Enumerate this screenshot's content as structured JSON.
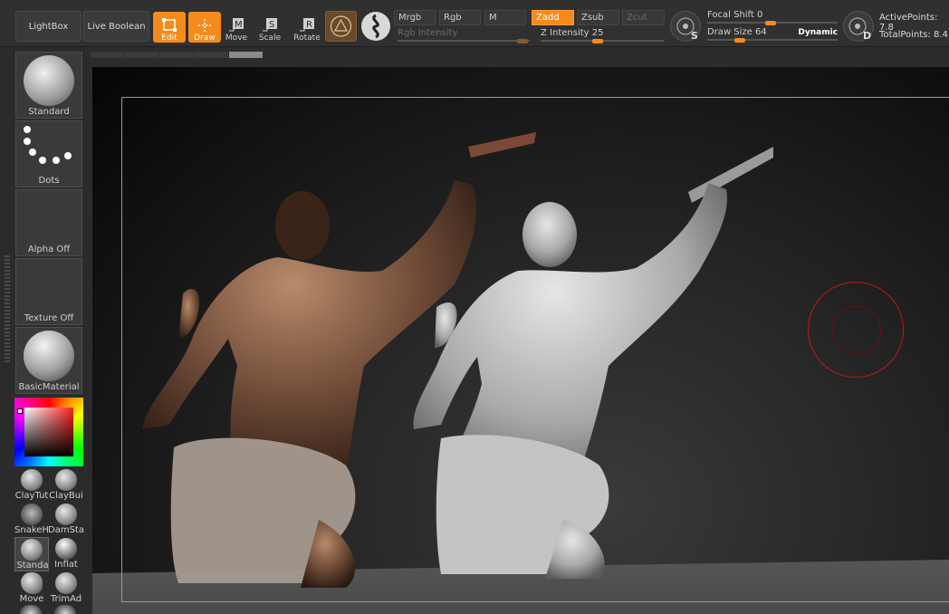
{
  "toolbar": {
    "lightbox": "LightBox",
    "live_boolean": "Live Boolean",
    "tools": [
      {
        "label": "Edit",
        "active": true
      },
      {
        "label": "Draw",
        "active": true
      },
      {
        "label": "Move",
        "active": false
      },
      {
        "label": "Scale",
        "active": false
      },
      {
        "label": "Rotate",
        "active": false
      }
    ],
    "modes": {
      "mrgb": "Mrgb",
      "rgb": "Rgb",
      "m": "M",
      "zadd": "Zadd",
      "zsub": "Zsub",
      "zcut": "Zcut"
    },
    "rgb_intensity": "Rgb Intensity",
    "z_intensity": "Z Intensity 25",
    "focal_shift": "Focal Shift 0",
    "draw_size": "Draw Size 64",
    "dynamic": "Dynamic",
    "active_points": "ActivePoints: 7.8",
    "total_points": "TotalPoints: 8.4",
    "icons": {
      "s": "S",
      "d": "D",
      "m": "M",
      "sc": "S",
      "r": "R"
    }
  },
  "leftpanel": {
    "brush": "Standard",
    "stroke": "Dots",
    "alpha": "Alpha Off",
    "texture": "Texture Off",
    "material": "BasicMaterial",
    "brushes": [
      {
        "label": "ClayTut",
        "selected": false
      },
      {
        "label": "ClayBui",
        "selected": false
      },
      {
        "label": "SnakeH",
        "selected": false
      },
      {
        "label": "DamSta",
        "selected": false
      },
      {
        "label": "Standa",
        "selected": true
      },
      {
        "label": "Inflat",
        "selected": false
      },
      {
        "label": "Move",
        "selected": false
      },
      {
        "label": "TrimAd",
        "selected": false
      }
    ]
  },
  "colors": {
    "accent": "#f48b1c",
    "cursor": "#c01818"
  }
}
